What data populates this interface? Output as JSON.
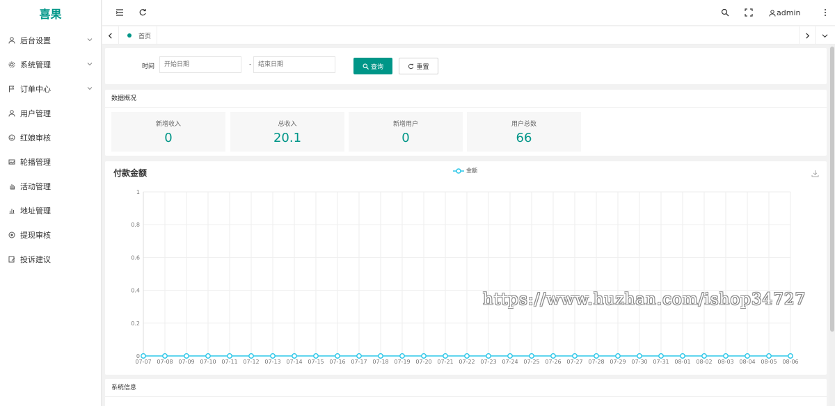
{
  "brand": {
    "name": "喜果",
    "accent": "#009688"
  },
  "sidebar": {
    "items": [
      {
        "label": "后台设置",
        "icon": "user-icon",
        "expandable": true
      },
      {
        "label": "系统管理",
        "icon": "gear-icon",
        "expandable": true
      },
      {
        "label": "订单中心",
        "icon": "flag-icon",
        "expandable": true
      },
      {
        "label": "用户管理",
        "icon": "user-icon",
        "expandable": false
      },
      {
        "label": "红娘审核",
        "icon": "smile-icon",
        "expandable": false
      },
      {
        "label": "轮播管理",
        "icon": "image-icon",
        "expandable": false
      },
      {
        "label": "活动管理",
        "icon": "hand-icon",
        "expandable": false
      },
      {
        "label": "地址管理",
        "icon": "chart-icon",
        "expandable": false
      },
      {
        "label": "提现审核",
        "icon": "target-icon",
        "expandable": false
      },
      {
        "label": "投诉建议",
        "icon": "edit-icon",
        "expandable": false
      }
    ]
  },
  "topbar": {
    "user": "admin"
  },
  "tabs": {
    "home": "首页"
  },
  "search": {
    "time_label": "时间",
    "start_placeholder": "开始日期",
    "end_placeholder": "结束日期",
    "separator": "-",
    "query_label": "查询",
    "reset_label": "重置"
  },
  "overview": {
    "title": "数据概况",
    "stats": [
      {
        "label": "新增收入",
        "value": "0"
      },
      {
        "label": "总收入",
        "value": "20.1"
      },
      {
        "label": "新增用户",
        "value": "0"
      },
      {
        "label": "用户总数",
        "value": "66"
      }
    ]
  },
  "chart": {
    "title": "付款金额"
  },
  "chart_data": {
    "type": "line",
    "title": "付款金额",
    "series": [
      {
        "name": "金额",
        "values": [
          0,
          0,
          0,
          0,
          0,
          0,
          0,
          0,
          0,
          0,
          0,
          0,
          0,
          0,
          0,
          0,
          0,
          0,
          0,
          0,
          0,
          0,
          0,
          0,
          0,
          0,
          0,
          0,
          0,
          0,
          0
        ]
      }
    ],
    "x": [
      "07-07",
      "07-08",
      "07-09",
      "07-10",
      "07-11",
      "07-12",
      "07-13",
      "07-14",
      "07-15",
      "07-16",
      "07-17",
      "07-18",
      "07-19",
      "07-20",
      "07-21",
      "07-22",
      "07-23",
      "07-24",
      "07-25",
      "07-26",
      "07-27",
      "07-28",
      "07-29",
      "07-30",
      "07-31",
      "08-01",
      "08-02",
      "08-03",
      "08-04",
      "08-05",
      "08-06"
    ],
    "ylim": [
      0,
      1
    ],
    "yticks": [
      "0",
      "0.2",
      "0.4",
      "0.6",
      "0.8",
      "1"
    ],
    "grid": true,
    "legend": "top-center",
    "color": "#2ec7e8"
  },
  "system_info": {
    "title": "系统信息"
  },
  "watermark": "https://www.huzhan.com/ishop34727"
}
